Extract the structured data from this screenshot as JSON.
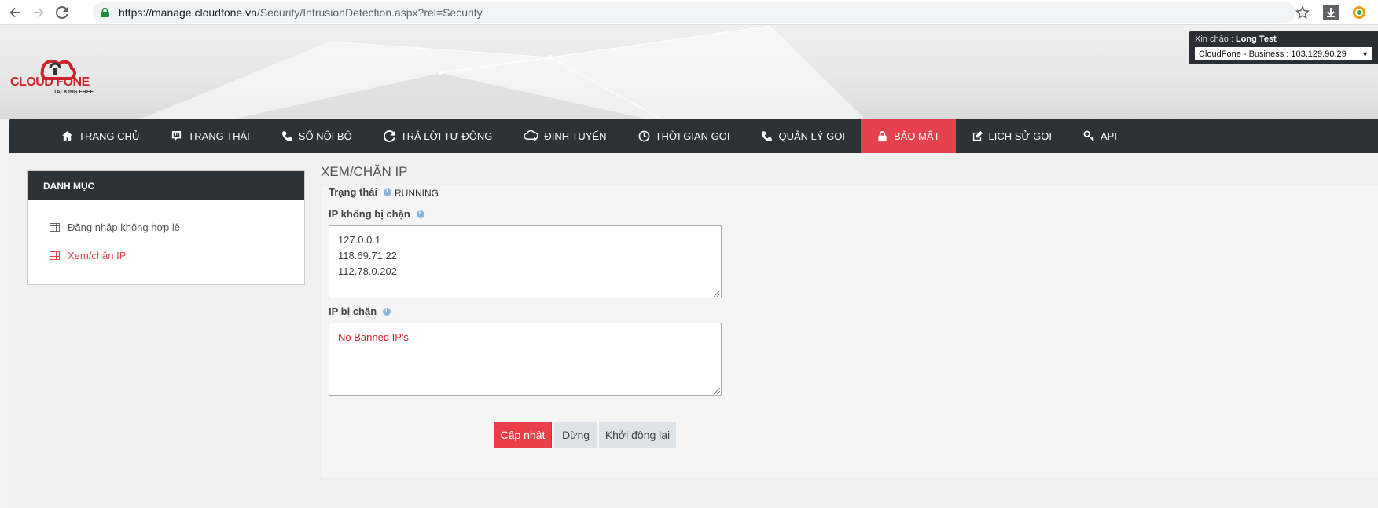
{
  "browser": {
    "url_host": "https://manage.cloudfone.vn",
    "url_path": "/Security/IntrusionDetection.aspx?rel=Security",
    "icons": [
      "back-arrow-icon",
      "forward-arrow-icon",
      "reload-icon",
      "lock-icon",
      "star-icon",
      "download-icon",
      "extension-icon"
    ]
  },
  "header": {
    "logo_text": "CLOUD FONE",
    "logo_tagline": "TALKING FREE",
    "greeting_prefix": "Xin chào :",
    "user_name": "Long Test",
    "account_selected": "CloudFone - Business : 103.129.90.29"
  },
  "nav": {
    "items": [
      {
        "label": "TRANG CHỦ",
        "icon": "home-icon"
      },
      {
        "label": "TRẠNG THÁI",
        "icon": "status-icon"
      },
      {
        "label": "SỔ NỘI BỘ",
        "icon": "phone-icon"
      },
      {
        "label": "TRẢ LỜI TỰ ĐỘNG",
        "icon": "refresh-icon"
      },
      {
        "label": "ĐỊNH TUYẾN",
        "icon": "cloud-route-icon"
      },
      {
        "label": "THỜI GIAN GỌI",
        "icon": "clock-icon"
      },
      {
        "label": "QUẢN LÝ GỌI",
        "icon": "phone-icon"
      },
      {
        "label": "BẢO MẬT",
        "icon": "lock-icon",
        "active": true
      },
      {
        "label": "LỊCH SỬ GỌI",
        "icon": "edit-icon"
      },
      {
        "label": "API",
        "icon": "key-icon"
      }
    ],
    "active_color": "#e5424d"
  },
  "sidebar": {
    "title": "DANH MỤC",
    "items": [
      {
        "label": "Đăng nhập không hợp lệ",
        "icon": "table-icon"
      },
      {
        "label": "Xem/chặn IP",
        "icon": "table-icon",
        "active": true
      }
    ]
  },
  "main": {
    "title": "XEM/CHẶN IP",
    "status_label": "Trạng thái",
    "status_value": "RUNNING",
    "whitelist_label": "IP không bị chặn",
    "whitelist": [
      "127.0.0.1",
      "118.69.71.22",
      "112.78.0.202"
    ],
    "banned_label": "IP bị chặn",
    "banned": [
      "No Banned IP's"
    ],
    "buttons": {
      "update": "Cập nhật",
      "stop": "Dừng",
      "restart": "Khởi động lại"
    }
  }
}
